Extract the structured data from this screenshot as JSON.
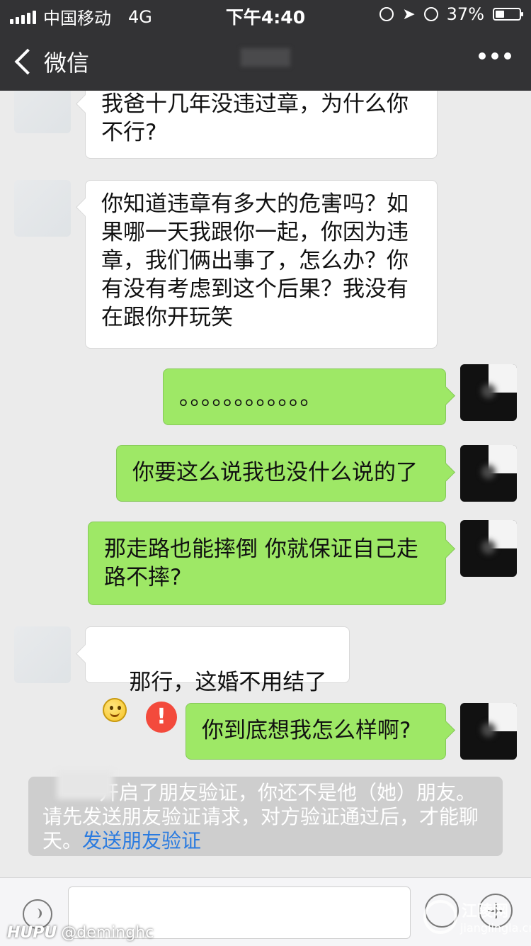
{
  "status_bar": {
    "carrier": "中国移动",
    "network": "4G",
    "time": "下午4:40",
    "battery": "37%"
  },
  "nav": {
    "back_label": "微信"
  },
  "messages": [
    {
      "side": "left",
      "text": "我爸十几年没违过章，为什么你不行?"
    },
    {
      "side": "left",
      "text": "你知道违章有多大的危害吗？如果哪一天我跟你一起，你因为违章，我们俩出事了，怎么办？你有没有考虑到这个后果？我没有在跟你开玩笑"
    },
    {
      "side": "right",
      "text": "。。。。。。。。。。。。"
    },
    {
      "side": "right",
      "text": "你要这么说我也没什么说的了"
    },
    {
      "side": "right",
      "text": "那走路也能摔倒 你就保证自己走路不摔?"
    },
    {
      "side": "left",
      "text": "那行，这婚不用结了"
    },
    {
      "side": "right",
      "text": "你到底想我怎么样啊?",
      "failed": true
    }
  ],
  "system_notice": {
    "text": "开启了朋友验证，你还不是他（她）朋友。请先发送朋友验证请求，对方验证通过后，才能聊天。",
    "link": "发送朋友验证"
  },
  "watermarks": {
    "left_brand": "HUPU",
    "left_handle": "@deminghc",
    "right_site": "江陵网",
    "right_url": "jianglingla.cn"
  },
  "colors": {
    "bar": "#333335",
    "background": "#ebebeb",
    "bubble_sent": "#9ee866",
    "bubble_received": "#ffffff",
    "error": "#f34a3c",
    "link": "#2a7be0"
  }
}
